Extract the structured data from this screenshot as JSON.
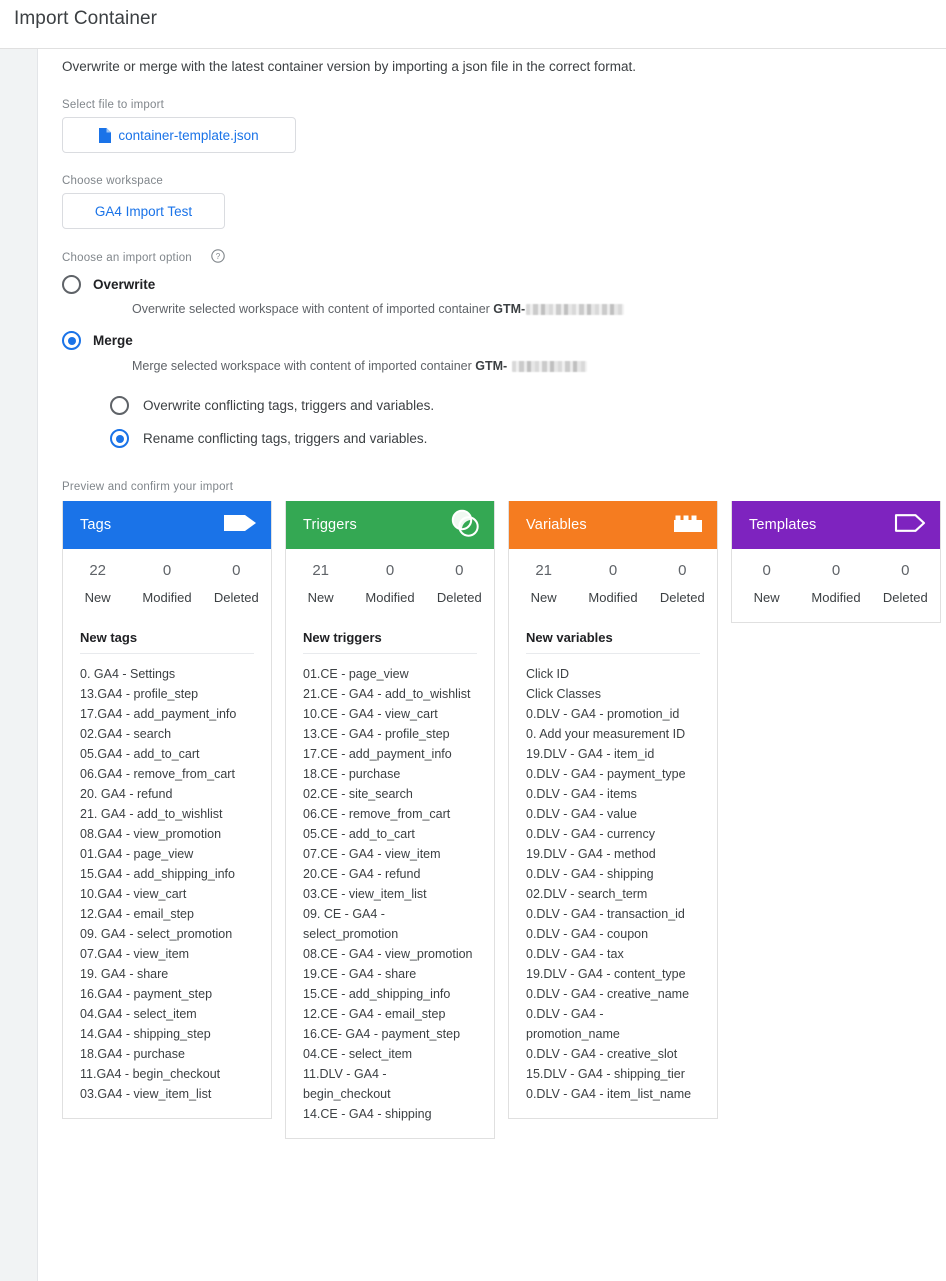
{
  "window": {
    "title": "Import Container"
  },
  "main": {
    "intro": "Overwrite or merge with the latest container version by importing a json file in the correct format.",
    "file": {
      "label": "Select file to import",
      "name": "container-template.json",
      "icon": "document-icon"
    },
    "workspace": {
      "label": "Choose workspace",
      "name": "GA4 Import Test"
    },
    "import_option": {
      "label": "Choose an import option",
      "help_icon": "help-circle-icon",
      "options": [
        {
          "key": "overwrite",
          "label": "Overwrite",
          "description_prefix": "Overwrite selected workspace with content of imported container ",
          "description_bold": "GTM-",
          "redacted": true,
          "selected": false
        },
        {
          "key": "merge",
          "label": "Merge",
          "description_prefix": "Merge selected workspace with content of imported container ",
          "description_bold": "GTM-",
          "redacted": true,
          "selected": true
        }
      ],
      "merge_sub_options": [
        {
          "key": "overwrite-conflicting",
          "label": "Overwrite conflicting tags, triggers and variables.",
          "selected": false
        },
        {
          "key": "rename-conflicting",
          "label": "Rename conflicting tags, triggers and variables.",
          "selected": true
        }
      ]
    },
    "preview": {
      "label": "Preview and confirm your import",
      "count_captions": [
        "New",
        "Modified",
        "Deleted"
      ],
      "cards": [
        {
          "key": "tags",
          "title": "Tags",
          "icon": "tag-filled-icon",
          "color": "#1a73e8",
          "counts": [
            "22",
            "0",
            "0"
          ],
          "section_title": "New tags",
          "items": [
            "0. GA4 - Settings",
            "13.GA4 - profile_step",
            "17.GA4 - add_payment_info",
            "02.GA4 - search",
            "05.GA4 - add_to_cart",
            "06.GA4 - remove_from_cart",
            "20. GA4 - refund",
            "21. GA4 - add_to_wishlist",
            "08.GA4 - view_promotion",
            "01.GA4 - page_view",
            "15.GA4 - add_shipping_info",
            "10.GA4 - view_cart",
            "12.GA4 - email_step",
            "09. GA4 - select_promotion",
            "07.GA4 - view_item",
            "19. GA4 - share",
            "16.GA4 - payment_step",
            "04.GA4 - select_item",
            "14.GA4 - shipping_step",
            "18.GA4 - purchase",
            "11.GA4 - begin_checkout",
            "03.GA4 - view_item_list"
          ]
        },
        {
          "key": "triggers",
          "title": "Triggers",
          "icon": "trigger-circles-icon",
          "color": "#34a853",
          "counts": [
            "21",
            "0",
            "0"
          ],
          "section_title": "New triggers",
          "items": [
            "01.CE - page_view",
            "21.CE - GA4 - add_to_wishlist",
            "10.CE - GA4 - view_cart",
            "13.CE - GA4 - profile_step",
            "17.CE - add_payment_info",
            "18.CE - purchase",
            "02.CE - site_search",
            "06.CE - remove_from_cart",
            "05.CE - add_to_cart",
            "07.CE - GA4 - view_item",
            "20.CE - GA4 - refund",
            "03.CE - view_item_list",
            "09. CE - GA4 - select_promotion",
            "08.CE - GA4 - view_promotion",
            "19.CE - GA4 - share",
            "15.CE - add_shipping_info",
            "12.CE - GA4 - email_step",
            "16.CE- GA4 - payment_step",
            "04.CE - select_item",
            "11.DLV - GA4 - begin_checkout",
            "14.CE - GA4 - shipping"
          ]
        },
        {
          "key": "variables",
          "title": "Variables",
          "icon": "brick-icon",
          "color": "#f57c20",
          "counts": [
            "21",
            "0",
            "0"
          ],
          "section_title": "New variables",
          "items": [
            "Click ID",
            "Click Classes",
            "0.DLV - GA4 - promotion_id",
            "0. Add your measurement ID",
            "19.DLV - GA4 - item_id",
            "0.DLV - GA4 - payment_type",
            "0.DLV - GA4 - items",
            "0.DLV - GA4 - value",
            "0.DLV - GA4 - currency",
            "19.DLV - GA4 - method",
            "0.DLV - GA4 - shipping",
            "02.DLV - search_term",
            "0.DLV - GA4 - transaction_id",
            "0.DLV - GA4 - coupon",
            "0.DLV - GA4 - tax",
            "19.DLV - GA4 - content_type",
            "0.DLV - GA4 - creative_name",
            "0.DLV - GA4 - promotion_name",
            "0.DLV - GA4 - creative_slot",
            "15.DLV - GA4 - shipping_tier",
            "0.DLV - GA4 - item_list_name"
          ]
        },
        {
          "key": "templates",
          "title": "Templates",
          "icon": "tag-outline-icon",
          "color": "#7e23bf",
          "counts": [
            "0",
            "0",
            "0"
          ],
          "section_title": "",
          "items": []
        }
      ]
    }
  }
}
